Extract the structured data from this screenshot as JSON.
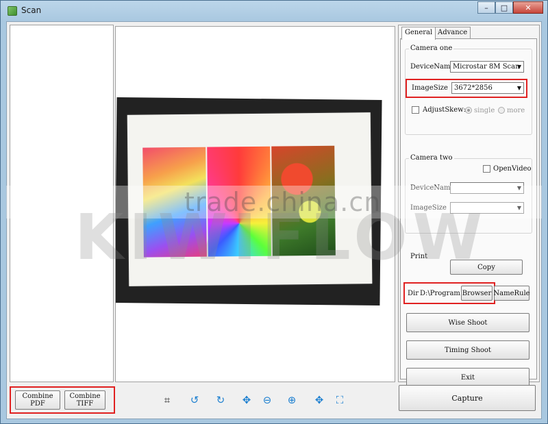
{
  "window": {
    "title": "Scan",
    "minimize": "–",
    "maximize": "□",
    "close": "✕"
  },
  "left": {
    "combine_pdf": [
      "Combine",
      "PDF"
    ],
    "combine_tiff": [
      "Combine",
      "TIFF"
    ]
  },
  "watermark": {
    "line1": "trade.china.cn",
    "line2": "KIWIFLOW"
  },
  "toolbar": {
    "icons": [
      "crop-icon",
      "rotate-left-icon",
      "rotate-right-icon",
      "move-icon",
      "zoom-out-icon",
      "zoom-in-icon",
      "fit-icon",
      "fullscreen-icon"
    ]
  },
  "tabs": {
    "general": "General",
    "advance": "Advance"
  },
  "camera_one": {
    "label": "Camera one",
    "device_label": "DeviceName",
    "device_value": "Microstar 8M Scan",
    "size_label": "ImageSize",
    "size_value": "3672*2856",
    "adjust_skew": "AdjustSkew:",
    "single": "single",
    "more": "more"
  },
  "camera_two": {
    "label": "Camera two",
    "open_video": "OpenVideo",
    "device_label": "DeviceName",
    "size_label": "ImageSize"
  },
  "print": {
    "label": "Print",
    "copy": "Copy"
  },
  "dir": {
    "label": "Dir",
    "value": "D:\\Program",
    "browser": "Browser",
    "name_rule": "NameRule"
  },
  "actions": {
    "wise_shoot": "Wise Shoot",
    "timing_shoot": "Timing Shoot",
    "exit": "Exit",
    "capture": "Capture"
  },
  "colors": {
    "highlight": "#e02020",
    "titlebar": "#a9c8e0"
  }
}
